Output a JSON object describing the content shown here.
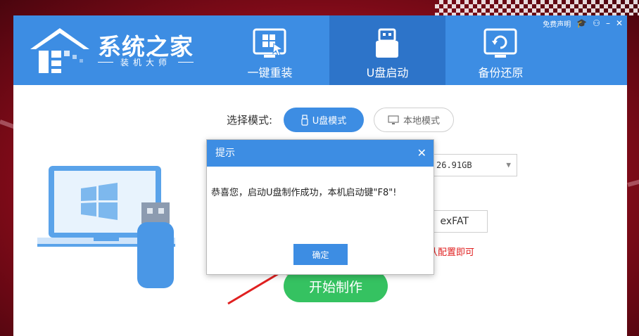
{
  "brand": {
    "title": "系统之家",
    "subtitle": "装机大师"
  },
  "tabs": [
    {
      "label": "一键重装",
      "icon": "windows-install-icon"
    },
    {
      "label": "U盘启动",
      "icon": "usb-drive-icon",
      "active": true
    },
    {
      "label": "备份还原",
      "icon": "backup-restore-icon"
    }
  ],
  "top_links": {
    "disclaimer": "免费声明"
  },
  "mode": {
    "label": "选择模式:",
    "usb": "U盘模式",
    "local": "本地模式"
  },
  "device": {
    "value": "26.91GB"
  },
  "filesystem": {
    "value": "exFAT"
  },
  "red_note": "认配置即可",
  "start_button": "开始制作",
  "dialog": {
    "title": "提示",
    "message": "恭喜您，启动U盘制作成功，本机启动键\"F8\"!",
    "ok": "确定"
  },
  "colors": {
    "primary": "#3d8de3",
    "active_tab": "#2d74c9",
    "start": "#35c261",
    "annotation": "#e02020"
  }
}
